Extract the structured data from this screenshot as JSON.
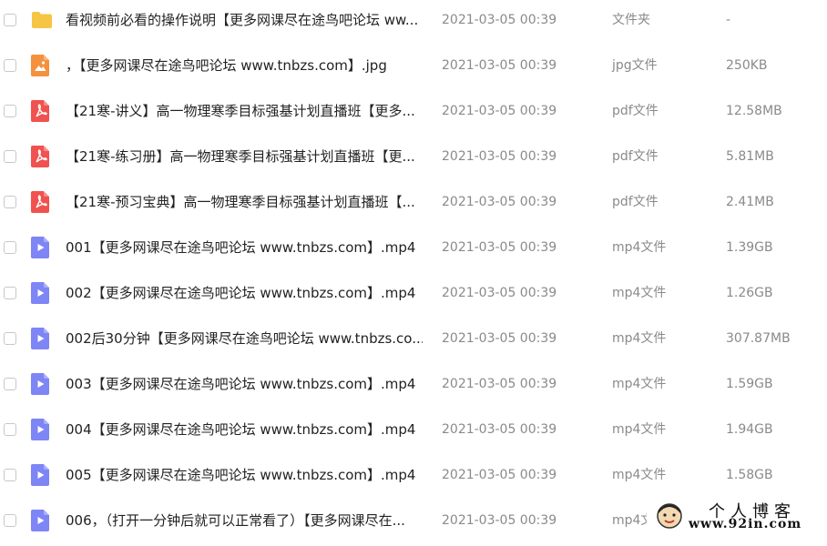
{
  "files": [
    {
      "icon": "folder-icon",
      "name": "看视频前必看的操作说明【更多网课尽在途鸟吧论坛 ww...",
      "date": "2021-03-05 00:39",
      "type": "文件夹",
      "size": "-"
    },
    {
      "icon": "image-file-icon",
      "name": "，【更多网课尽在途鸟吧论坛 www.tnbzs.com】.jpg",
      "date": "2021-03-05 00:39",
      "type": "jpg文件",
      "size": "250KB"
    },
    {
      "icon": "pdf-file-icon",
      "name": "【21寒-讲义】高一物理寒季目标强基计划直播班【更多...",
      "date": "2021-03-05 00:39",
      "type": "pdf文件",
      "size": "12.58MB"
    },
    {
      "icon": "pdf-file-icon",
      "name": "【21寒-练习册】高一物理寒季目标强基计划直播班【更...",
      "date": "2021-03-05 00:39",
      "type": "pdf文件",
      "size": "5.81MB"
    },
    {
      "icon": "pdf-file-icon",
      "name": "【21寒-预习宝典】高一物理寒季目标强基计划直播班【...",
      "date": "2021-03-05 00:39",
      "type": "pdf文件",
      "size": "2.41MB"
    },
    {
      "icon": "video-file-icon",
      "name": "001【更多网课尽在途鸟吧论坛 www.tnbzs.com】.mp4",
      "date": "2021-03-05 00:39",
      "type": "mp4文件",
      "size": "1.39GB"
    },
    {
      "icon": "video-file-icon",
      "name": "002【更多网课尽在途鸟吧论坛 www.tnbzs.com】.mp4",
      "date": "2021-03-05 00:39",
      "type": "mp4文件",
      "size": "1.26GB"
    },
    {
      "icon": "video-file-icon",
      "name": "002后30分钟【更多网课尽在途鸟吧论坛 www.tnbzs.co...",
      "date": "2021-03-05 00:39",
      "type": "mp4文件",
      "size": "307.87MB"
    },
    {
      "icon": "video-file-icon",
      "name": "003【更多网课尽在途鸟吧论坛 www.tnbzs.com】.mp4",
      "date": "2021-03-05 00:39",
      "type": "mp4文件",
      "size": "1.59GB"
    },
    {
      "icon": "video-file-icon",
      "name": "004【更多网课尽在途鸟吧论坛 www.tnbzs.com】.mp4",
      "date": "2021-03-05 00:39",
      "type": "mp4文件",
      "size": "1.94GB"
    },
    {
      "icon": "video-file-icon",
      "name": "005【更多网课尽在途鸟吧论坛 www.tnbzs.com】.mp4",
      "date": "2021-03-05 00:39",
      "type": "mp4文件",
      "size": "1.58GB"
    },
    {
      "icon": "video-file-icon",
      "name": "006，（打开一分钟后就可以正常看了）【更多网课尽在...",
      "date": "2021-03-05 00:39",
      "type": "mp4文",
      "size": ""
    }
  ],
  "colors": {
    "folder": "#F7C544",
    "image": "#F5913E",
    "pdf": "#F0524F",
    "video": "#7E85F5"
  },
  "watermark": {
    "title": "个人博客",
    "url": "www.92in.com"
  }
}
